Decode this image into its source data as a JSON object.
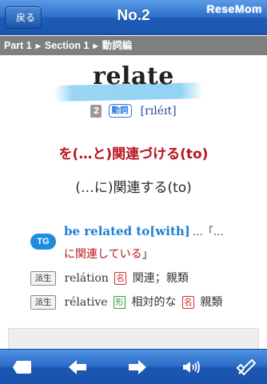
{
  "nav": {
    "back_label": "戻る",
    "title": "No.2",
    "logo": "ReseMom"
  },
  "breadcrumb": [
    "Part 1",
    "Section 1",
    "動詞編"
  ],
  "entry": {
    "word": "relate",
    "level": "2",
    "pos": "動詞",
    "pronunciation": "[rɪléɪt]",
    "meaning_primary": "を(…と)関連づける(to)",
    "meaning_secondary": "(…に)関連する(to)"
  },
  "example": {
    "badge": "TG",
    "phrase": "be related to[with]",
    "tail": "…「…",
    "translation_jp": "に関連している",
    "close": "」"
  },
  "derivatives": [
    {
      "badge": "派生",
      "word": "relátion",
      "tag1": "名",
      "meaning1": "関連；親類"
    },
    {
      "badge": "派生",
      "word": "rélative",
      "tag1": "形",
      "meaning1": "相対的な",
      "tag2": "名",
      "meaning2": "親類"
    }
  ],
  "toolbar": {
    "icons": [
      "bookmark-icon",
      "back-arrow-icon",
      "forward-arrow-icon",
      "speaker-icon",
      "edit-check-icon"
    ]
  },
  "colors": {
    "nav_blue": "#2d6fcb",
    "meaning_red": "#b8141e",
    "phrase_blue": "#1a7fd6",
    "breadcrumb_gray": "#7f7f7f"
  }
}
